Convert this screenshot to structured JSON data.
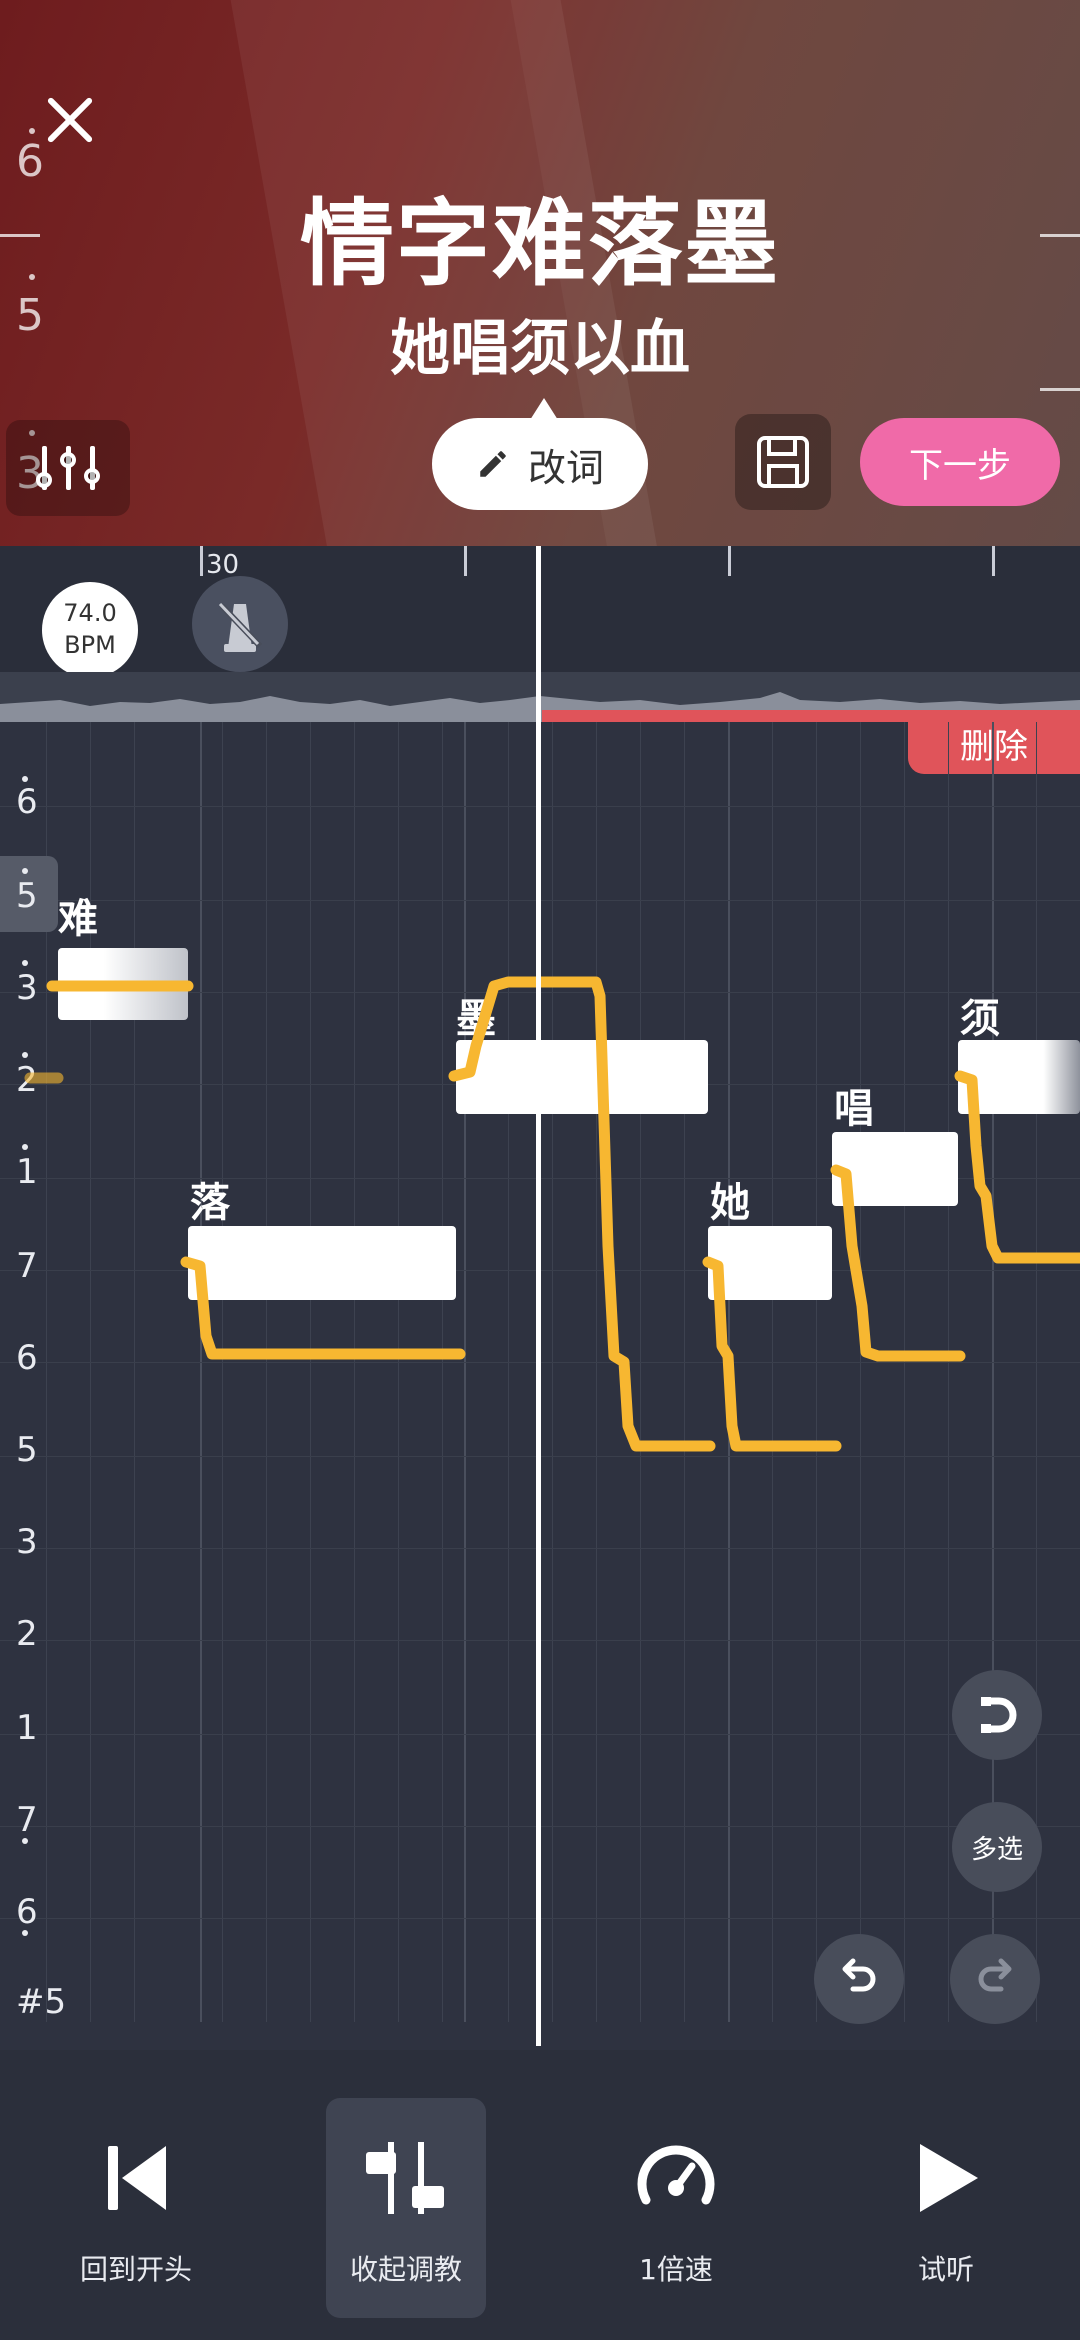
{
  "header": {
    "lyric_main": "情字难落墨",
    "lyric_sub": "她唱须以血",
    "pitch_labels": [
      "6",
      "5",
      "3"
    ],
    "edit_lyrics_label": "改词",
    "next_label": "下一步"
  },
  "editor": {
    "ruler_number": "30",
    "bpm_value": "74.0",
    "bpm_unit": "BPM",
    "delete_label": "删除",
    "pitch_labels": [
      "6",
      "5",
      "3",
      "2",
      "1",
      "7",
      "6",
      "5",
      "3",
      "2",
      "1",
      "7",
      "6",
      "#5"
    ],
    "notes": [
      {
        "word": "难"
      },
      {
        "word": "落"
      },
      {
        "word": "墨"
      },
      {
        "word": "她"
      },
      {
        "word": "唱"
      },
      {
        "word": "须"
      }
    ],
    "multiselect_label": "多选",
    "pitch_curve_color": "#f7b731"
  },
  "bottom_bar": {
    "items": [
      {
        "label": "回到开头",
        "icon": "skip-back-icon"
      },
      {
        "label": "收起调教",
        "icon": "sliders-icon"
      },
      {
        "label": "1倍速",
        "icon": "speedometer-icon"
      },
      {
        "label": "试听",
        "icon": "play-icon"
      }
    ]
  },
  "colors": {
    "accent_pink": "#f06aa8",
    "delete_red": "#e0545a",
    "pitch_yellow": "#f7b731"
  }
}
